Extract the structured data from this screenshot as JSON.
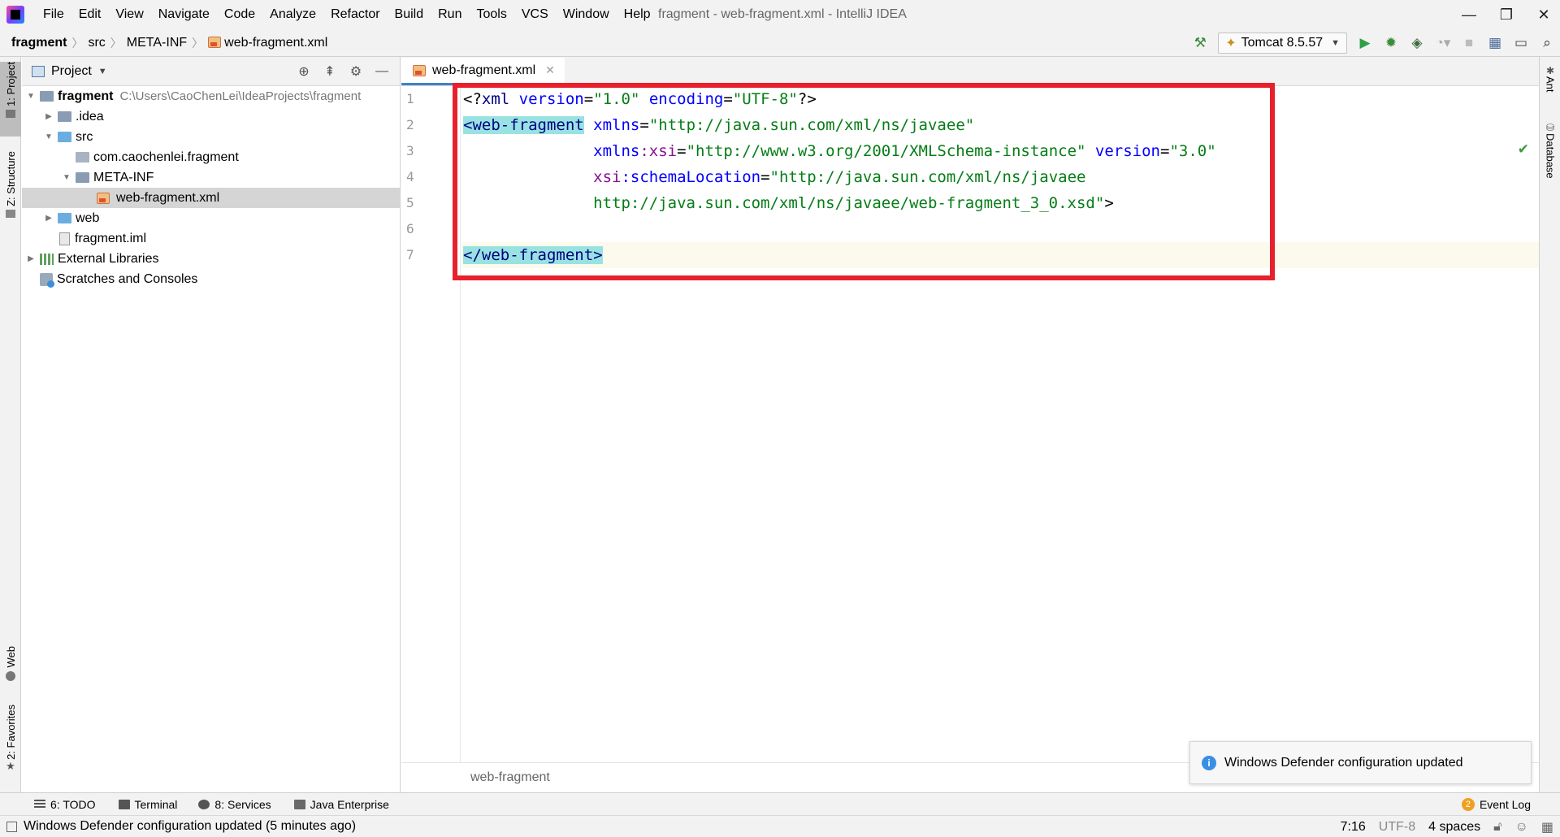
{
  "window": {
    "title": "fragment - web-fragment.xml - IntelliJ IDEA",
    "minimize": "—",
    "restore": "❐",
    "close": "✕"
  },
  "menu": [
    "File",
    "Edit",
    "View",
    "Navigate",
    "Code",
    "Analyze",
    "Refactor",
    "Build",
    "Run",
    "Tools",
    "VCS",
    "Window",
    "Help"
  ],
  "breadcrumb": [
    "fragment",
    "src",
    "META-INF",
    "web-fragment.xml"
  ],
  "toolbar": {
    "run_config": "Tomcat 8.5.57",
    "icons": [
      "hammer-icon",
      "run-icon",
      "debug-icon",
      "coverage-icon",
      "profile-icon",
      "stop-icon",
      "project-structure-icon",
      "layout-icon",
      "search-icon"
    ]
  },
  "left_strip": {
    "project_tab": "1: Project",
    "structure_tab": "Z: Structure",
    "web_tab": "Web",
    "favorites_tab": "2: Favorites"
  },
  "right_strip": {
    "ant_tab": "Ant",
    "database_tab": "Database"
  },
  "project_panel": {
    "title": "Project",
    "tree": [
      {
        "label": "fragment",
        "path": "C:\\Users\\CaoChenLei\\IdeaProjects\\fragment",
        "depth": 0,
        "expanded": true,
        "kind": "module"
      },
      {
        "label": ".idea",
        "depth": 1,
        "expanded": false,
        "kind": "folder"
      },
      {
        "label": "src",
        "depth": 1,
        "expanded": true,
        "kind": "source-folder"
      },
      {
        "label": "com.caochenlei.fragment",
        "depth": 2,
        "kind": "package"
      },
      {
        "label": "META-INF",
        "depth": 2,
        "expanded": true,
        "kind": "folder"
      },
      {
        "label": "web-fragment.xml",
        "depth": 3,
        "kind": "xml-file",
        "selected": true
      },
      {
        "label": "web",
        "depth": 1,
        "expanded": false,
        "kind": "web-folder"
      },
      {
        "label": "fragment.iml",
        "depth": 1,
        "kind": "iml-file"
      },
      {
        "label": "External Libraries",
        "depth": 0,
        "expanded": false,
        "kind": "libraries"
      },
      {
        "label": "Scratches and Consoles",
        "depth": 0,
        "kind": "scratches"
      }
    ]
  },
  "editor": {
    "tab_label": "web-fragment.xml",
    "line_numbers": [
      "1",
      "2",
      "3",
      "4",
      "5",
      "6",
      "7"
    ],
    "breadcrumb": "web-fragment",
    "code": {
      "l1_open": "<?",
      "l1_tag": "xml",
      "l1_a1": " version",
      "l1_eq1": "=",
      "l1_v1": "\"1.0\"",
      "l1_a2": " encoding",
      "l1_eq2": "=",
      "l1_v2": "\"UTF-8\"",
      "l1_close": "?>",
      "l2_open": "<",
      "l2_tag": "web-fragment",
      "l2_a1": " xmlns",
      "l2_eq1": "=",
      "l2_v1": "\"http://java.sun.com/xml/ns/javaee\"",
      "l3_indent": "              ",
      "l3_a1": "xmlns",
      "l3_ns": ":xsi",
      "l3_eq1": "=",
      "l3_v1": "\"http://www.w3.org/2001/XMLSchema-instance\"",
      "l3_a2": " version",
      "l3_eq2": "=",
      "l3_v2": "\"3.0\"",
      "l4_indent": "              ",
      "l4_ns": "xsi",
      "l4_a1": ":schemaLocation",
      "l4_eq1": "=",
      "l4_v1": "\"http://java.sun.com/xml/ns/javaee",
      "l5_indent": "              ",
      "l5_v1": "http://java.sun.com/xml/ns/javaee/web-fragment_3_0.xsd\"",
      "l5_close": ">",
      "l7_open": "</",
      "l7_tag": "web-fragment",
      "l7_close": ">"
    }
  },
  "notification": {
    "message": "Windows Defender configuration updated"
  },
  "bottom_tools": [
    {
      "label": "6: TODO",
      "icon": "todo-icon"
    },
    {
      "label": "Terminal",
      "icon": "terminal-icon"
    },
    {
      "label": "8: Services",
      "icon": "services-icon"
    },
    {
      "label": "Java Enterprise",
      "icon": "java-enterprise-icon"
    }
  ],
  "event_log": {
    "label": "Event Log",
    "count": "2"
  },
  "status": {
    "message": "Windows Defender configuration updated (5 minutes ago)",
    "position": "7:16",
    "encoding": "UTF-8",
    "indent": "4 spaces"
  },
  "colors": {
    "annotation": "#e8202c",
    "tag": "#000080",
    "attr": "#0000ff",
    "namespace": "#871094",
    "value": "#067d17"
  }
}
